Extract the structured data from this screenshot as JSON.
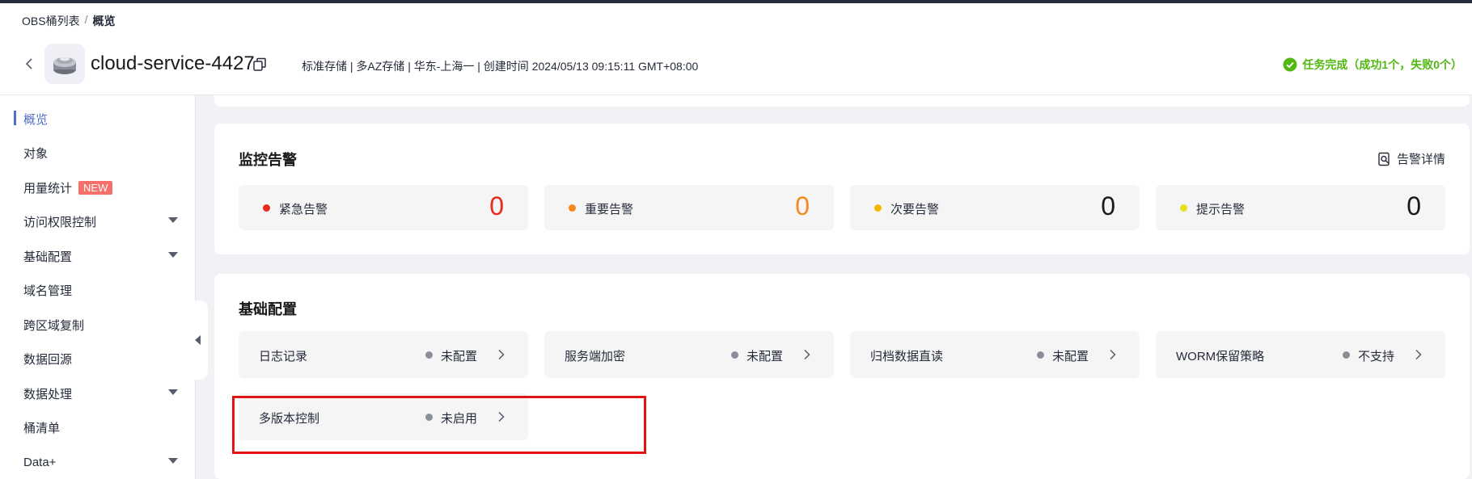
{
  "colors": {
    "accent": "#526ecc",
    "success": "#50b810",
    "urgent": "#e8291c",
    "important": "#f5891c",
    "minor": "#f5b800",
    "hint": "#e8e01c",
    "highlight": "#e01414"
  },
  "breadcrumb": {
    "parent": "OBS桶列表",
    "separator": "/",
    "current": "概览"
  },
  "header": {
    "bucket_name": "cloud-service-4427",
    "meta": "标准存储 | 多AZ存储 | 华东-上海一 | 创建时间  2024/05/13 09:15:11 GMT+08:00",
    "task_status": "任务完成（成功1个，失败0个）",
    "icons": [
      "chevron-left-icon",
      "bucket-icon",
      "copy-icon",
      "check-circle-icon"
    ]
  },
  "sidebar": {
    "items": [
      {
        "label": "概览",
        "active": true
      },
      {
        "label": "对象"
      },
      {
        "label": "用量统计",
        "badge": "NEW"
      },
      {
        "label": "访问权限控制",
        "expandable": true
      },
      {
        "label": "基础配置",
        "expandable": true
      },
      {
        "label": "域名管理"
      },
      {
        "label": "跨区域复制"
      },
      {
        "label": "数据回源"
      },
      {
        "label": "数据处理",
        "expandable": true
      },
      {
        "label": "桶清单"
      },
      {
        "label": "Data+",
        "expandable": true
      }
    ]
  },
  "monitor": {
    "title": "监控告警",
    "detail_link": "告警详情",
    "alarms": [
      {
        "label": "紧急告警",
        "count": "0",
        "level": "urgent"
      },
      {
        "label": "重要告警",
        "count": "0",
        "level": "important"
      },
      {
        "label": "次要告警",
        "count": "0",
        "level": "minor"
      },
      {
        "label": "提示告警",
        "count": "0",
        "level": "hint"
      }
    ]
  },
  "basic_config": {
    "title": "基础配置",
    "items": [
      {
        "label": "日志记录",
        "status": "未配置"
      },
      {
        "label": "服务端加密",
        "status": "未配置"
      },
      {
        "label": "归档数据直读",
        "status": "未配置"
      },
      {
        "label": "WORM保留策略",
        "status": "不支持"
      },
      {
        "label": "多版本控制",
        "status": "未启用"
      }
    ]
  }
}
